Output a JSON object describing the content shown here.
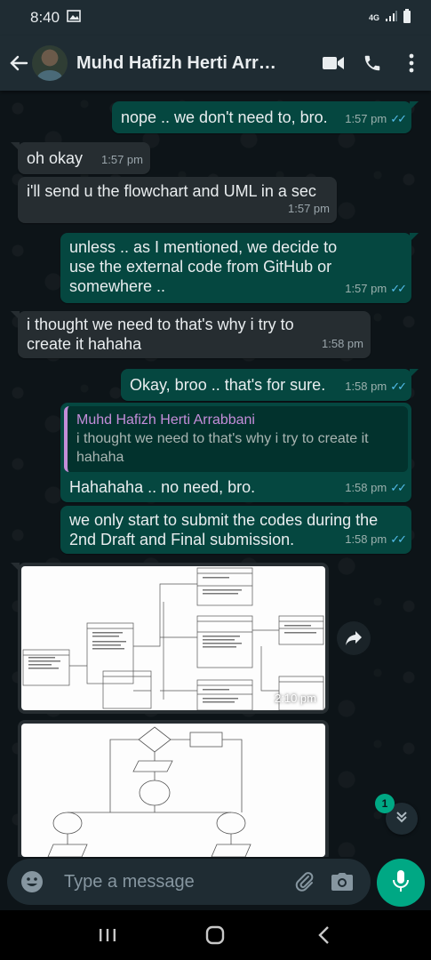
{
  "status_bar": {
    "time": "8:40",
    "network": "4G"
  },
  "header": {
    "contact_name": "Muhd Hafizh Herti Arra..."
  },
  "messages": [
    {
      "text": "nope .. we don't need to, bro.",
      "time": "1:57 pm",
      "ticks": "✓✓"
    },
    {
      "text": "oh okay",
      "time": "1:57 pm"
    },
    {
      "text": "i'll send u the flowchart and UML in a sec",
      "time": "1:57 pm"
    },
    {
      "text": "unless .. as I mentioned, we decide to use the external code from GitHub or somewhere ..",
      "time": "1:57 pm",
      "ticks": "✓✓"
    },
    {
      "text": "i thought we need to that's why i try to create it hahaha",
      "time": "1:58 pm"
    },
    {
      "text": "Okay, broo .. that's for sure.",
      "time": "1:58 pm",
      "ticks": "✓✓"
    },
    {
      "quote_author": "Muhd Hafizh Herti Arrabbani",
      "quote_text": "i thought we need to that's why i try to create it hahaha",
      "text": "Hahahaha .. no need, bro.",
      "time": "1:58 pm",
      "ticks": "✓✓"
    },
    {
      "text": "we only start to submit the codes during the 2nd Draft and Final submission.",
      "time": "1:58 pm",
      "ticks": "✓✓"
    },
    {
      "image_desc": "uml-class-diagram-image",
      "time": "2:10 pm"
    },
    {
      "image_desc": "flowchart-image"
    }
  ],
  "scroll": {
    "unread_count": "1"
  },
  "composer": {
    "placeholder": "Type a message"
  },
  "colors": {
    "incoming_bubble": "#262d31",
    "outgoing_bubble": "#054740",
    "accent": "#00a884",
    "read_ticks": "#53bdeb",
    "quote_bar": "#c48dd9"
  },
  "icons": [
    "back-arrow-icon",
    "video-call-icon",
    "phone-icon",
    "more-vert-icon",
    "forward-icon",
    "chevron-down-double-icon",
    "emoji-icon",
    "attach-icon",
    "camera-icon",
    "mic-icon",
    "recents-icon",
    "home-icon",
    "back-nav-icon"
  ]
}
